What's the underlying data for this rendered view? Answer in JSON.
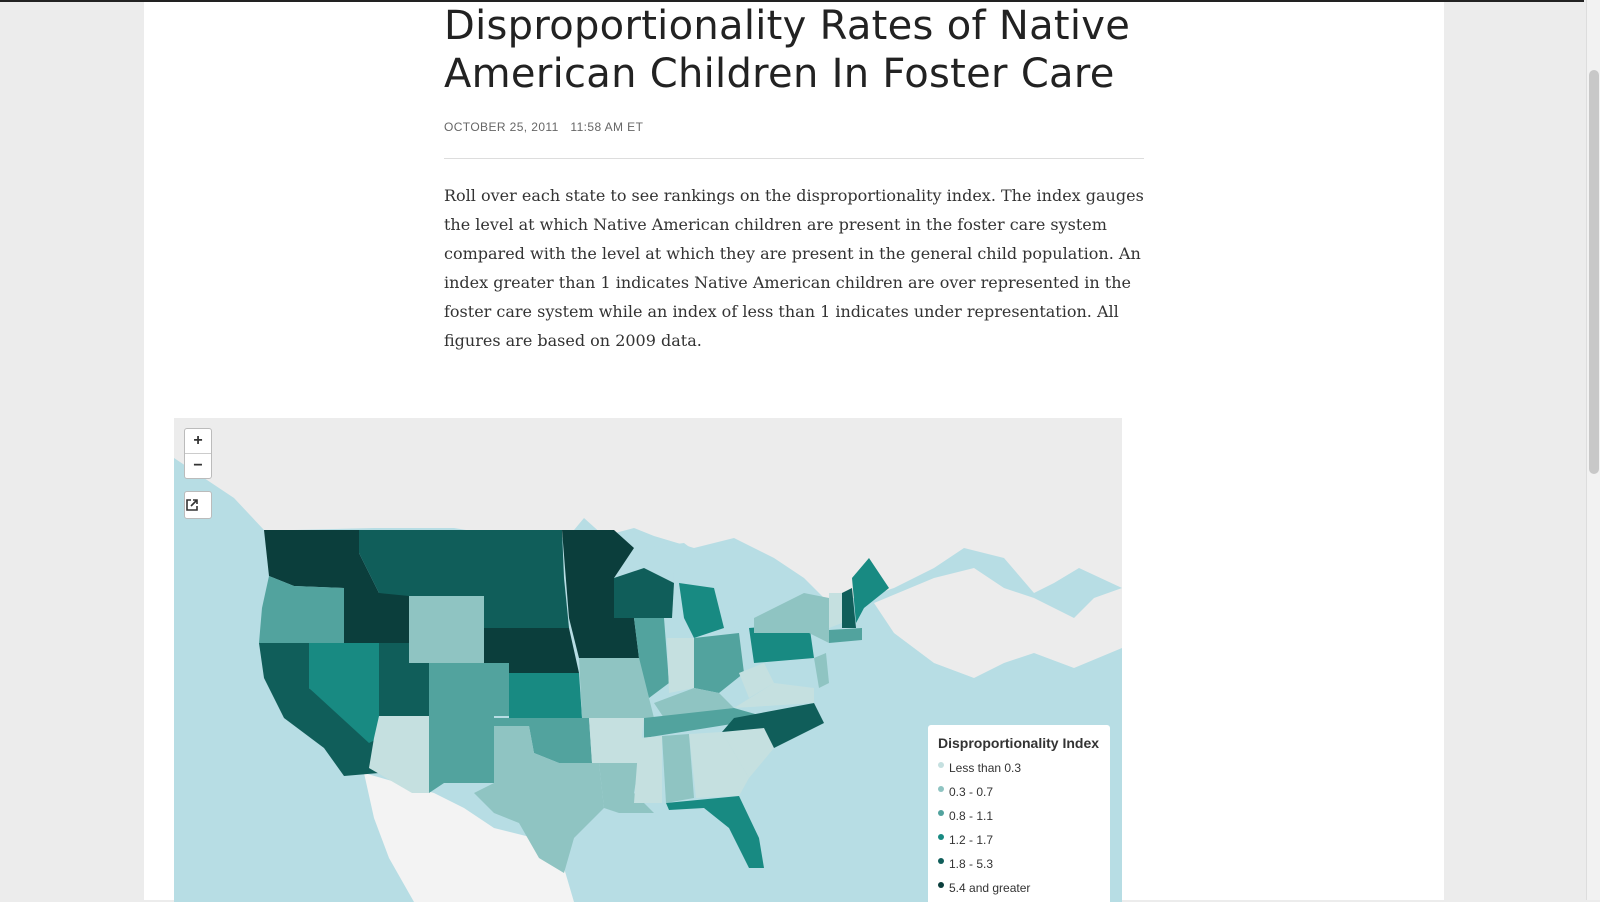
{
  "article": {
    "title": "Disproportionality Rates of Native American Children In Foster Care",
    "date": "OCTOBER 25, 2011",
    "time": "11:58 AM ET",
    "body": "Roll over each state to see rankings on the disproportionality index. The index gauges the level at which Native American children are present in the foster care system compared with the level at which they are present in the general child population. An index greater than 1 indicates Native American children are over represented in the foster care system while an index of less than 1 indicates under representation. All figures are based on 2009 data."
  },
  "map": {
    "zoom_in_label": "+",
    "zoom_out_label": "−",
    "share_icon": "external-link-icon",
    "legend": {
      "title": "Disproportionality Index",
      "items": [
        {
          "label": "Less than 0.3",
          "color": "#c5e0e0"
        },
        {
          "label": "0.3 - 0.7",
          "color": "#8fc4c2"
        },
        {
          "label": "0.8 - 1.1",
          "color": "#52a39e"
        },
        {
          "label": "1.2 - 1.7",
          "color": "#188a82"
        },
        {
          "label": "1.8 - 5.3",
          "color": "#105e5a"
        },
        {
          "label": "5.4 and greater",
          "color": "#0b3e3c"
        }
      ]
    },
    "colors": {
      "water": "#b7dde4",
      "land": "#ececec",
      "mexico": "#f3f3f3"
    }
  }
}
